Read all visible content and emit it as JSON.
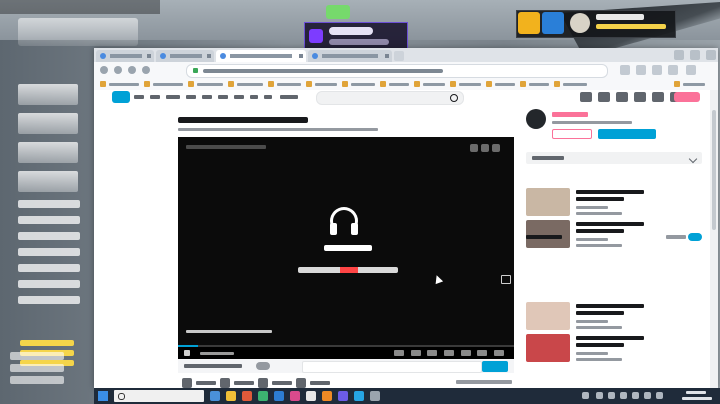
{
  "colors": {
    "bilibili_blue": "#00a1d6",
    "bilibili_pink": "#fb7299",
    "queue_purple": "#7d3cff",
    "queue_green": "#76d96c",
    "accent_red": "#ff4545",
    "gold": "#f2b21d"
  },
  "icons": {
    "headphones": "headphones-icon",
    "search": "search-icon",
    "windows_start": "windows-start-icon",
    "lock": "lock-icon"
  },
  "recommendations": {
    "thumb_colors": [
      "#c9b7a4",
      "#7a6a63",
      "#e0c7b8",
      "#c9474a",
      "#e07c2a",
      "#3b2d2a",
      "#b7c3cf",
      "#6e5e4c",
      "#2f2a28"
    ]
  }
}
